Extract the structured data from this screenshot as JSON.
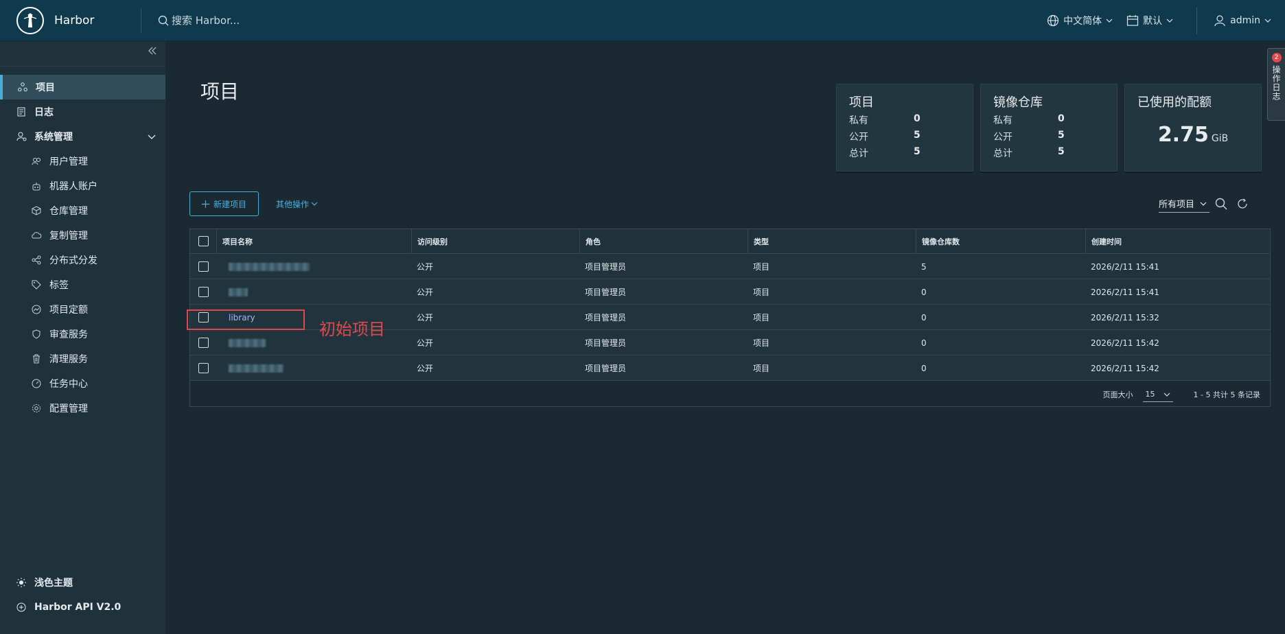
{
  "header": {
    "brand": "Harbor",
    "search_placeholder": "搜索 Harbor...",
    "language": "中文简体",
    "date_format": "默认",
    "user": "admin"
  },
  "sidebar": {
    "items": [
      {
        "label": "项目",
        "icon": "projects-icon",
        "active": true
      },
      {
        "label": "日志",
        "icon": "logs-icon"
      },
      {
        "label": "系统管理",
        "icon": "admin-icon",
        "expanded": true
      },
      {
        "label": "用户管理",
        "icon": "users-icon"
      },
      {
        "label": "机器人账户",
        "icon": "robot-icon"
      },
      {
        "label": "仓库管理",
        "icon": "registry-icon"
      },
      {
        "label": "复制管理",
        "icon": "replication-icon"
      },
      {
        "label": "分布式分发",
        "icon": "distribution-icon"
      },
      {
        "label": "标签",
        "icon": "tag-icon"
      },
      {
        "label": "项目定额",
        "icon": "quota-icon"
      },
      {
        "label": "审查服务",
        "icon": "shield-icon"
      },
      {
        "label": "清理服务",
        "icon": "trash-icon"
      },
      {
        "label": "任务中心",
        "icon": "dashboard-icon"
      },
      {
        "label": "配置管理",
        "icon": "gear-icon"
      }
    ],
    "footer": {
      "theme": "浅色主题",
      "api": "Harbor API V2.0"
    }
  },
  "main": {
    "title": "项目",
    "cards": {
      "projects": {
        "title": "项目",
        "private_label": "私有",
        "private": "0",
        "public_label": "公开",
        "public": "5",
        "total_label": "总计",
        "total": "5"
      },
      "repos": {
        "title": "镜像仓库",
        "private_label": "私有",
        "private": "0",
        "public_label": "公开",
        "public": "5",
        "total_label": "总计",
        "total": "5"
      },
      "quota": {
        "title": "已使用的配额",
        "value": "2.75",
        "unit": "GiB"
      }
    },
    "new_project": "新建项目",
    "other_actions": "其他操作",
    "filter": "所有项目"
  },
  "table": {
    "columns": [
      "项目名称",
      "访问级别",
      "角色",
      "类型",
      "镜像仓库数",
      "创建时间"
    ],
    "rows": [
      {
        "name": "",
        "access": "公开",
        "role": "项目管理员",
        "type": "项目",
        "repos": "5",
        "created": "2026/2/11 15:41"
      },
      {
        "name": "",
        "access": "公开",
        "role": "项目管理员",
        "type": "项目",
        "repos": "0",
        "created": "2026/2/11 15:41"
      },
      {
        "name": "library",
        "access": "公开",
        "role": "项目管理员",
        "type": "项目",
        "repos": "0",
        "created": "2026/2/11 15:32"
      },
      {
        "name": "",
        "access": "公开",
        "role": "项目管理员",
        "type": "项目",
        "repos": "0",
        "created": "2026/2/11 15:42"
      },
      {
        "name": "",
        "access": "公开",
        "role": "项目管理员",
        "type": "项目",
        "repos": "0",
        "created": "2026/2/11 15:42"
      }
    ],
    "page_size_label": "页面大小",
    "page_size": "15",
    "summary": "1 - 5 共计 5 条记录"
  },
  "annotation": "初始项目",
  "side_tab": {
    "badge": "2",
    "label": "操作日志"
  },
  "colors": {
    "accent": "#49afd9",
    "header": "#0f3a4e",
    "annotation": "#e0484b"
  }
}
